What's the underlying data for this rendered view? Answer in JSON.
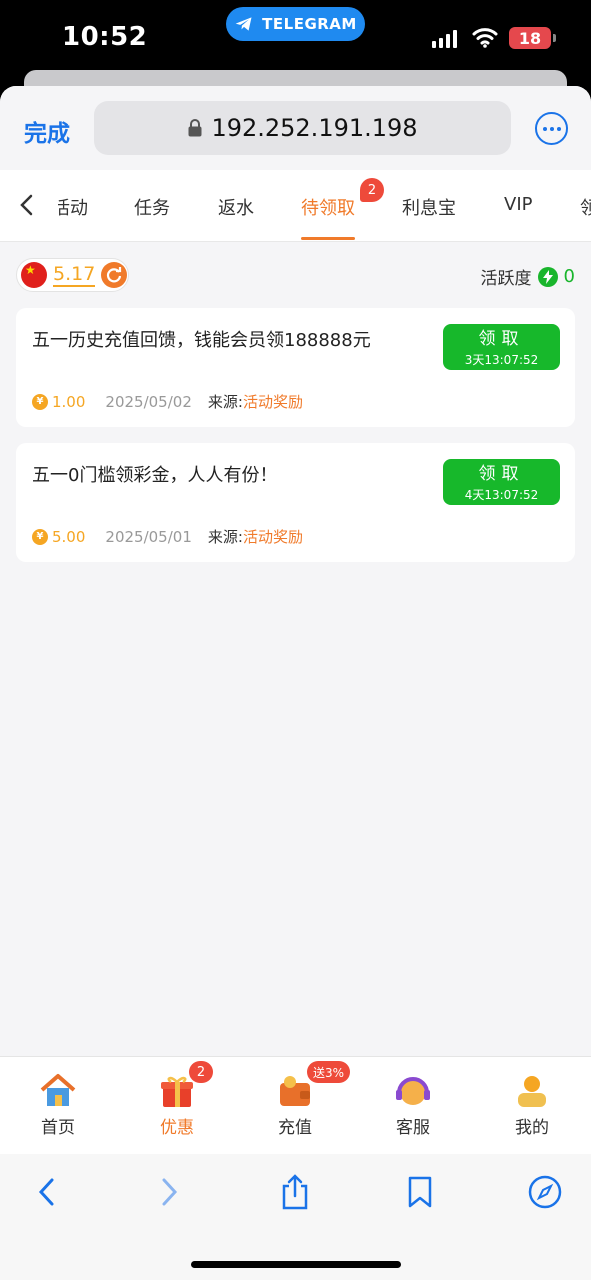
{
  "status_bar": {
    "time": "10:52",
    "pill_label": "TELEGRAM",
    "battery": "18"
  },
  "browser": {
    "done_label": "完成",
    "url": "192.252.191.198"
  },
  "tabs": [
    {
      "label": "活动",
      "active": false
    },
    {
      "label": "任务",
      "active": false
    },
    {
      "label": "返水",
      "active": false
    },
    {
      "label": "待领取",
      "active": true,
      "badge": "2"
    },
    {
      "label": "利息宝",
      "active": false
    },
    {
      "label": "VIP",
      "active": false
    },
    {
      "label": "领",
      "active": false
    }
  ],
  "account": {
    "balance": "5.17",
    "activity_label": "活跃度",
    "activity_value": "0"
  },
  "rewards": [
    {
      "title": "五一历史充值回馈，钱能会员领188888元",
      "button_label": "领取",
      "countdown": "3天13:07:52",
      "amount": "1.00",
      "date": "2025/05/02",
      "source_label": "来源:",
      "source_value": "活动奖励"
    },
    {
      "title": "五一0门槛领彩金，人人有份！",
      "button_label": "领取",
      "countdown": "4天13:07:52",
      "amount": "5.00",
      "date": "2025/05/01",
      "source_label": "来源:",
      "source_value": "活动奖励"
    }
  ],
  "bottom_nav": [
    {
      "label": "首页",
      "icon": "house-icon"
    },
    {
      "label": "优惠",
      "icon": "gift-icon",
      "badge": "2",
      "active": true
    },
    {
      "label": "充值",
      "icon": "wallet-icon",
      "promo": "送3%"
    },
    {
      "label": "客服",
      "icon": "headset-icon"
    },
    {
      "label": "我的",
      "icon": "profile-icon"
    }
  ],
  "colors": {
    "accent": "#f07a2a",
    "green": "#17b82b",
    "link": "#1a73e8",
    "badge": "#ee4a3a"
  }
}
